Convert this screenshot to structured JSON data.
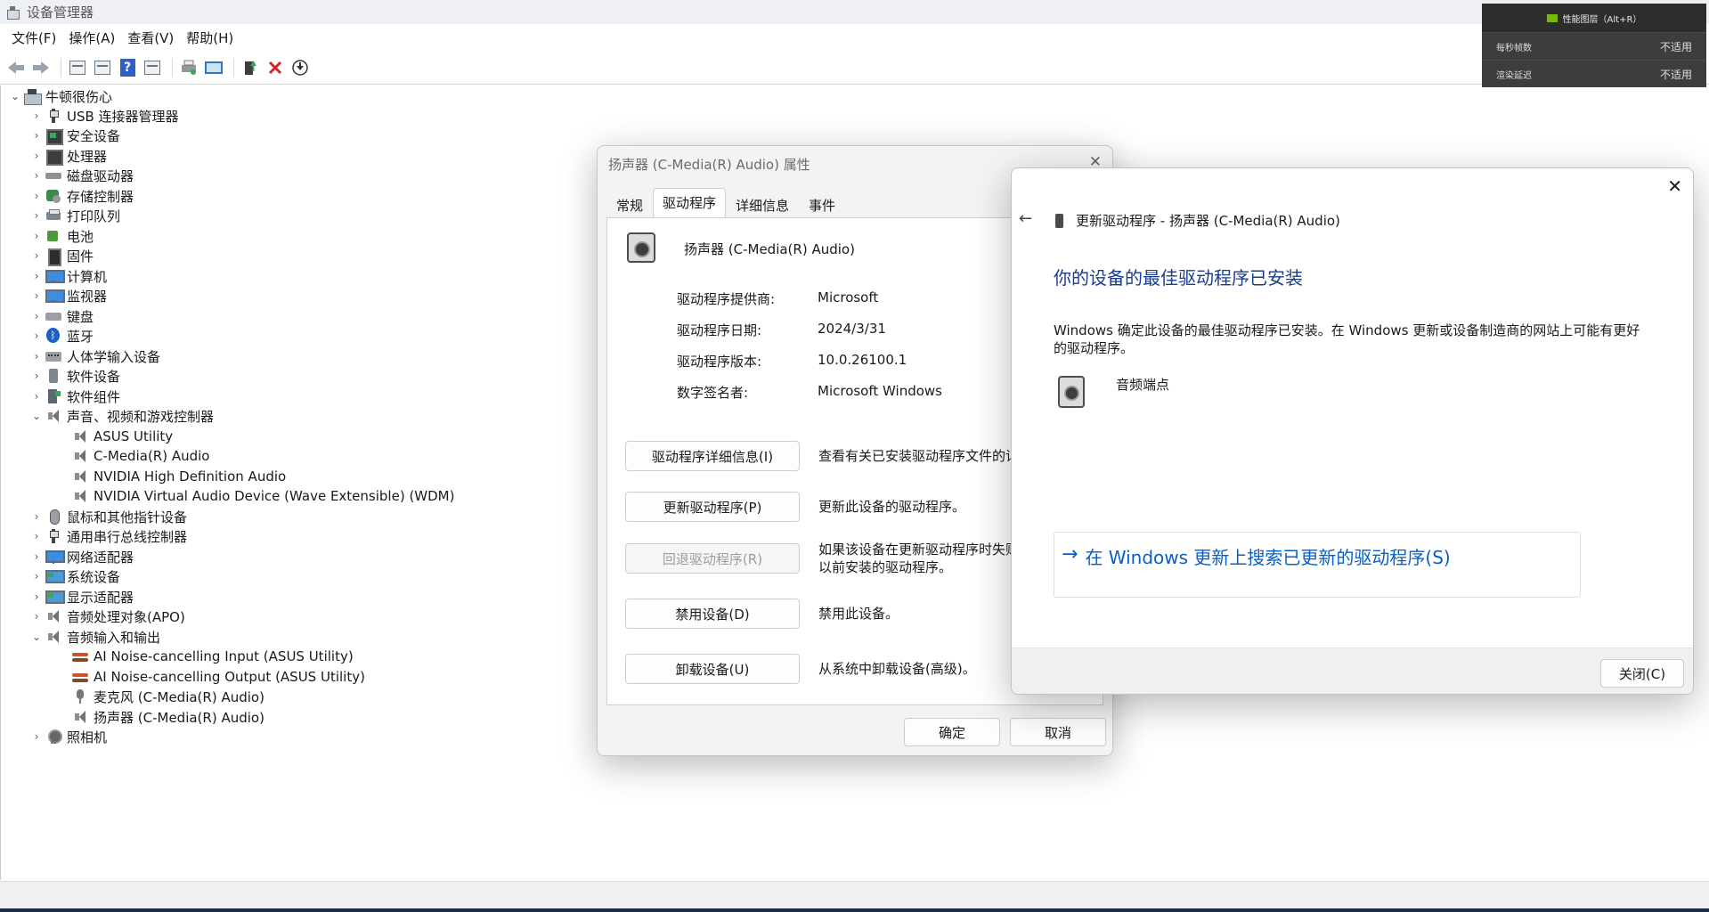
{
  "window": {
    "title": "设备管理器"
  },
  "menu": [
    "文件(F)",
    "操作(A)",
    "查看(V)",
    "帮助(H)"
  ],
  "toolbar": [
    "back-icon",
    "forward-icon",
    "properties-icon",
    "window-icon",
    "help-icon",
    "view-icon",
    "print-icon",
    "monitor-icon",
    "update-driver-icon",
    "uninstall-icon",
    "download-icon"
  ],
  "tree": {
    "root": "牛顿很伤心",
    "nodes": [
      {
        "label": "USB 连接器管理器",
        "icon": "usb-icon",
        "expanded": false
      },
      {
        "label": "安全设备",
        "icon": "security-icon",
        "expanded": false
      },
      {
        "label": "处理器",
        "icon": "processor-icon",
        "expanded": false
      },
      {
        "label": "磁盘驱动器",
        "icon": "disk-icon",
        "expanded": false
      },
      {
        "label": "存储控制器",
        "icon": "storage-icon",
        "expanded": false
      },
      {
        "label": "打印队列",
        "icon": "printer-icon",
        "expanded": false
      },
      {
        "label": "电池",
        "icon": "battery-icon",
        "expanded": false
      },
      {
        "label": "固件",
        "icon": "firmware-icon",
        "expanded": false
      },
      {
        "label": "计算机",
        "icon": "computer-icon",
        "expanded": false
      },
      {
        "label": "监视器",
        "icon": "monitor-icon",
        "expanded": false
      },
      {
        "label": "键盘",
        "icon": "keyboard-icon",
        "expanded": false
      },
      {
        "label": "蓝牙",
        "icon": "bluetooth-icon",
        "expanded": false
      },
      {
        "label": "人体学输入设备",
        "icon": "hid-icon",
        "expanded": false
      },
      {
        "label": "软件设备",
        "icon": "software-device-icon",
        "expanded": false
      },
      {
        "label": "软件组件",
        "icon": "software-component-icon",
        "expanded": false
      },
      {
        "label": "声音、视频和游戏控制器",
        "icon": "speaker-icon",
        "expanded": true,
        "children": [
          "ASUS Utility",
          "C-Media(R) Audio",
          "NVIDIA High Definition Audio",
          "NVIDIA Virtual Audio Device (Wave Extensible) (WDM)"
        ]
      },
      {
        "label": "鼠标和其他指针设备",
        "icon": "mouse-icon",
        "expanded": false
      },
      {
        "label": "通用串行总线控制器",
        "icon": "usb-icon",
        "expanded": false
      },
      {
        "label": "网络适配器",
        "icon": "network-icon",
        "expanded": false
      },
      {
        "label": "系统设备",
        "icon": "system-icon",
        "expanded": false
      },
      {
        "label": "显示适配器",
        "icon": "display-icon",
        "expanded": false
      },
      {
        "label": "音频处理对象(APO)",
        "icon": "speaker-icon",
        "expanded": false
      },
      {
        "label": "音频输入和输出",
        "icon": "speaker-icon",
        "expanded": true,
        "children": [
          "AI Noise-cancelling Input (ASUS Utility)",
          "AI Noise-cancelling Output (ASUS Utility)",
          "麦克风 (C-Media(R) Audio)",
          "扬声器 (C-Media(R) Audio)"
        ]
      },
      {
        "label": "照相机",
        "icon": "camera-icon",
        "expanded": false
      }
    ]
  },
  "overlay": {
    "title": "性能图层（Alt+R）",
    "rows": [
      {
        "label": "每秒帧数",
        "value": "不适用"
      },
      {
        "label": "渲染延迟",
        "value": "不适用"
      }
    ]
  },
  "properties": {
    "title": "扬声器 (C-Media(R) Audio) 属性",
    "tabs": [
      "常规",
      "驱动程序",
      "详细信息",
      "事件"
    ],
    "active_tab": "驱动程序",
    "device_name": "扬声器 (C-Media(R) Audio)",
    "fields": [
      {
        "label": "驱动程序提供商:",
        "value": "Microsoft"
      },
      {
        "label": "驱动程序日期:",
        "value": "2024/3/31"
      },
      {
        "label": "驱动程序版本:",
        "value": "10.0.26100.1"
      },
      {
        "label": "数字签名者:",
        "value": "Microsoft Windows"
      }
    ],
    "actions": [
      {
        "button": "驱动程序详细信息(I)",
        "desc": "查看有关已安装驱动程序文件的详",
        "enabled": true
      },
      {
        "button": "更新驱动程序(P)",
        "desc": "更新此设备的驱动程序。",
        "enabled": true
      },
      {
        "button": "回退驱动程序(R)",
        "desc": "如果该设备在更新驱动程序时失败",
        "desc2": "以前安装的驱动程序。",
        "enabled": false
      },
      {
        "button": "禁用设备(D)",
        "desc": "禁用此设备。",
        "enabled": true
      },
      {
        "button": "卸载设备(U)",
        "desc": "从系统中卸载设备(高级)。",
        "enabled": true
      }
    ],
    "ok": "确定",
    "cancel": "取消"
  },
  "update": {
    "header": "更新驱动程序 - 扬声器 (C-Media(R) Audio)",
    "heading": "你的设备的最佳驱动程序已安装",
    "body": "Windows 确定此设备的最佳驱动程序已安装。在 Windows 更新或设备制造商的网站上可能有更好的驱动程序。",
    "device_label": "音频端点",
    "link_arrow": "→",
    "link": "在 Windows 更新上搜索已更新的驱动程序(S)",
    "close": "关闭(C)"
  }
}
